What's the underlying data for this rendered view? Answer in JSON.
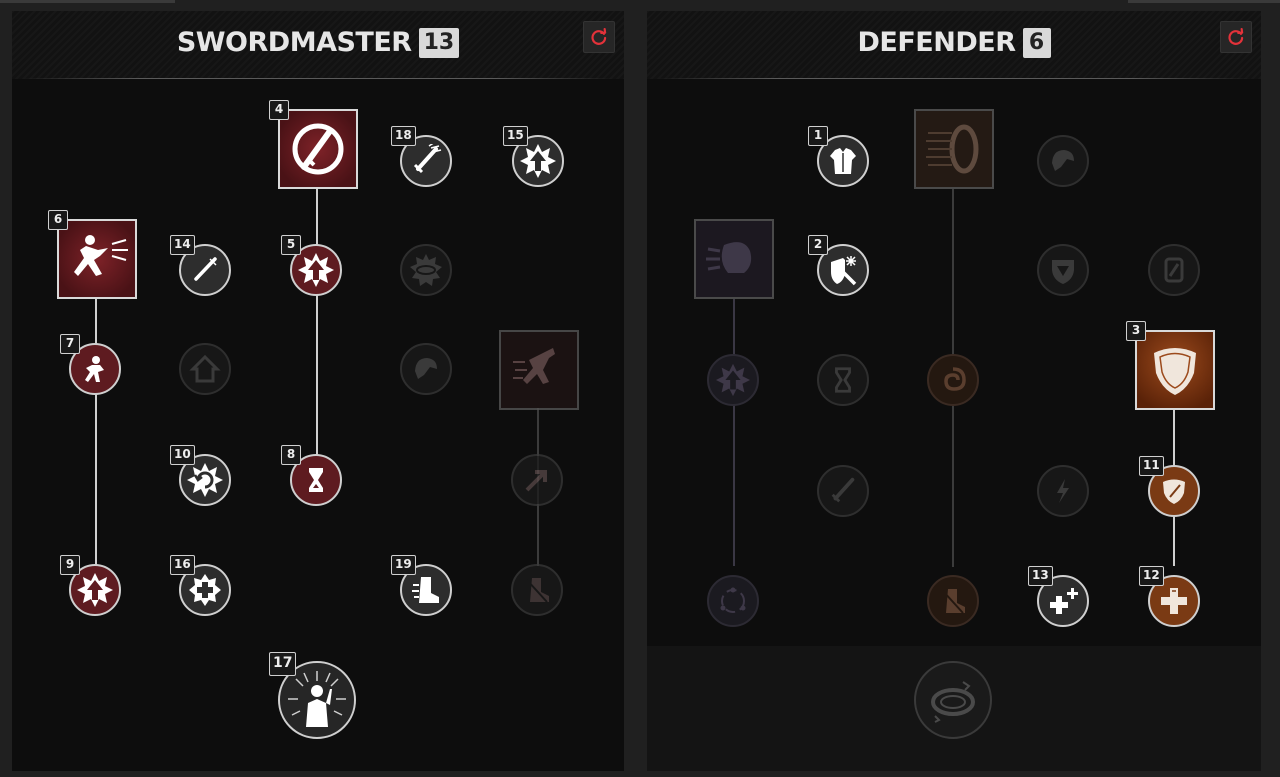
{
  "colors": {
    "panel": "#0d0d0d",
    "learned_red": "#5e1b20",
    "learned_orange": "#7a3a14",
    "reset_icon": "#e3323a",
    "lit_line": "#cfcfcf"
  },
  "trees": {
    "swordmaster": {
      "name": "SWORDMASTER",
      "points": "13",
      "reset_icon": "refresh-icon",
      "nodes": {
        "n4": {
          "order": "4",
          "icon": "sword-slash-icon"
        },
        "n18": {
          "order": "18",
          "icon": "sword-icon"
        },
        "n15": {
          "order": "15",
          "icon": "arrow-up-burst-icon"
        },
        "n6": {
          "order": "6",
          "icon": "dash-attack-icon"
        },
        "n14": {
          "order": "14",
          "icon": "sword-icon"
        },
        "n5": {
          "order": "5",
          "icon": "arrow-up-burst-icon"
        },
        "n7": {
          "order": "7",
          "icon": "fighter-icon"
        },
        "n10": {
          "order": "10",
          "icon": "burst-icon"
        },
        "n8": {
          "order": "8",
          "icon": "hourglass-icon"
        },
        "n9": {
          "order": "9",
          "icon": "arrow-up-burst-icon"
        },
        "n16": {
          "order": "16",
          "icon": "health-cross-icon"
        },
        "n19": {
          "order": "19",
          "icon": "boot-icon"
        },
        "n17": {
          "order": "17",
          "icon": "empowered-figure-icon"
        }
      }
    },
    "defender": {
      "name": "DEFENDER",
      "points": "6",
      "reset_icon": "refresh-icon",
      "nodes": {
        "n1": {
          "order": "1",
          "icon": "armor-icon"
        },
        "n2": {
          "order": "2",
          "icon": "shield-ice-icon"
        },
        "n3": {
          "order": "3",
          "icon": "shield-icon"
        },
        "n11": {
          "order": "11",
          "icon": "shield-icon"
        },
        "n13": {
          "order": "13",
          "icon": "health-cross-icon"
        },
        "n12": {
          "order": "12",
          "icon": "health-cross-icon"
        }
      }
    }
  }
}
